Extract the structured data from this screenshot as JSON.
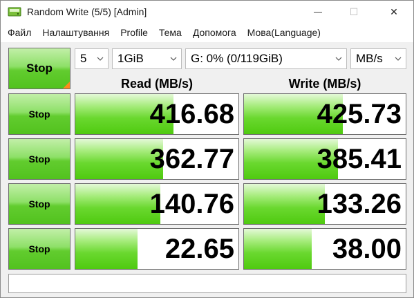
{
  "window": {
    "title": "Random Write (5/5) [Admin]",
    "minimize": "—",
    "maximize": "☐",
    "close": "✕"
  },
  "menu": {
    "items": [
      "Файл",
      "Налаштування",
      "Profile",
      "Тема",
      "Допомога",
      "Мова(Language)"
    ]
  },
  "controls": {
    "stop_all_label": "Stop",
    "test_count": "5",
    "test_size": "1GiB",
    "drive": "G: 0% (0/119GiB)",
    "unit": "MB/s"
  },
  "headers": {
    "read": "Read (MB/s)",
    "write": "Write (MB/s)"
  },
  "rows": [
    {
      "stop_label": "Stop",
      "read": "416.68",
      "write": "425.73",
      "read_fill": 0.6,
      "write_fill": 0.61
    },
    {
      "stop_label": "Stop",
      "read": "362.77",
      "write": "385.41",
      "read_fill": 0.54,
      "write_fill": 0.58
    },
    {
      "stop_label": "Stop",
      "read": "140.76",
      "write": "133.26",
      "read_fill": 0.52,
      "write_fill": 0.5
    },
    {
      "stop_label": "Stop",
      "read": "22.65",
      "write": "38.00",
      "read_fill": 0.38,
      "write_fill": 0.42
    }
  ],
  "comment": "",
  "colors": {
    "bar_green": "#4fca10",
    "stop_green": "#62cc2f",
    "corner_orange": "#ff8a1c"
  }
}
